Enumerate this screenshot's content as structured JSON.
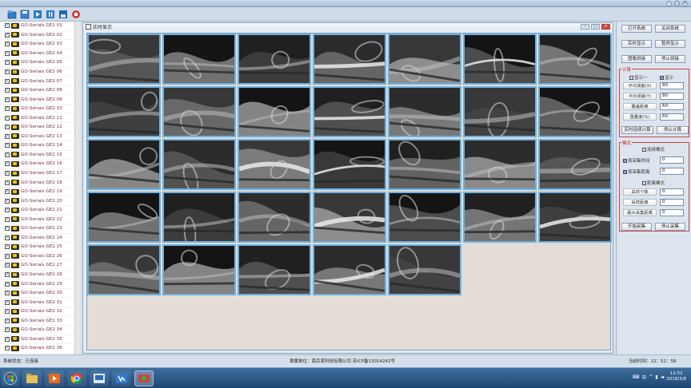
{
  "app": {
    "title": "",
    "toolbar_icons": [
      "folder-icon",
      "save-icon",
      "play-icon",
      "pause-icon",
      "disk-icon",
      "stop-icon"
    ]
  },
  "cameras": [
    "GO-Serials GE2 01",
    "GO-Serials GE2 02",
    "GO-Serials GE2 03",
    "GO-Serials GE2 04",
    "GO-Serials GE2 05",
    "GO-Serials GE2 06",
    "GO-Serials GE2 07",
    "GO-Serials GE2 08",
    "GO-Serials GE2 09",
    "GO-Serials GE2 10",
    "GO-Serials GE2 11",
    "GO-Serials GE2 12",
    "GO-Serials GE2 13",
    "GO-Serials GE2 14",
    "GO-Serials GE2 15",
    "GO-Serials GE2 16",
    "GO-Serials GE2 17",
    "GO-Serials GE2 18",
    "GO-Serials GE2 19",
    "GO-Serials GE2 20",
    "GO-Serials GE2 21",
    "GO-Serials GE2 22",
    "GO-Serials GE2 23",
    "GO-Serials GE2 24",
    "GO-Serials GE2 25",
    "GO-Serials GE2 26",
    "GO-Serials GE2 27",
    "GO-Serials GE2 28",
    "GO-Serials GE2 29",
    "GO-Serials GE2 30",
    "GO-Serials GE2 31",
    "GO-Serials GE2 32",
    "GO-Serials GE2 33",
    "GO-Serials GE2 34",
    "GO-Serials GE2 35",
    "GO-Serials GE2 36"
  ],
  "realtime_window": {
    "title": "实时显示",
    "tile_count": 33,
    "win_buttons": [
      "–",
      "□",
      "×"
    ]
  },
  "panel": {
    "btn_open_system": "打开系统",
    "btn_close_system": "关闭系统",
    "btn_realtime_display": "实时显示",
    "btn_pause_display": "暂停显示",
    "btn_stitch": "图像拼接",
    "btn_stop_stitch": "停止拼接",
    "group_calc": "计算",
    "opt_single": "显示一",
    "opt_display": "显示",
    "calc_labels": [
      "平均误差(X)",
      "平均误差(Y)",
      "覆盖距离",
      "重叠度(%)"
    ],
    "calc_values": [
      "80",
      "80",
      "60",
      "60"
    ],
    "btn_realtime_calc": "实时连续计算",
    "btn_stop_calc": "停止计算",
    "group_mode": "模式",
    "opt_continuous": "连续模式",
    "opt_interval": "按采集时间",
    "opt_distance": "按采集距离",
    "mode_values": [
      "0",
      "0"
    ],
    "opt_distance_mode": "距离模式",
    "dist_labels": [
      "采样个数",
      "采样距离",
      "最大采集距离"
    ],
    "dist_values": [
      "0",
      "0",
      "0"
    ],
    "btn_start_collect": "开始采集",
    "btn_stop_collect": "停止采集"
  },
  "status": {
    "left": "系统状态：已连接",
    "center": "隶属单位：南京某科技有限公司 苏ICP备13014242号",
    "right": "当前时间：12：52：58"
  },
  "taskbar": {
    "time": "12:52",
    "date": "2018/3/8",
    "lang": "中",
    "apps": [
      "windows-start-icon",
      "file-explorer-icon",
      "media-player-icon",
      "chrome-icon",
      "app-icon",
      "visual-studio-icon",
      "camera-app-icon"
    ]
  }
}
